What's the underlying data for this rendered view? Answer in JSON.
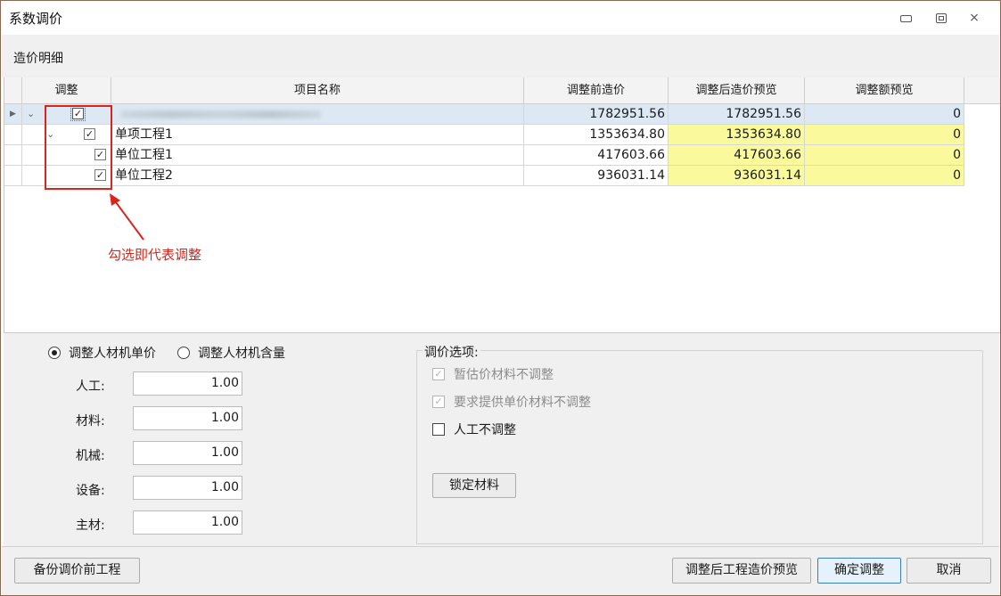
{
  "window": {
    "title": "系数调价",
    "close_glyph": "⨯"
  },
  "section": {
    "title": "造价明细"
  },
  "grid": {
    "columns": [
      "调整",
      "项目名称",
      "调整前造价",
      "调整后造价预览",
      "调整额预览"
    ],
    "rows": [
      {
        "name": "",
        "before": "1782951.56",
        "after": "1782951.56",
        "delta": "0"
      },
      {
        "name": "单项工程1",
        "before": "1353634.80",
        "after": "1353634.80",
        "delta": "0"
      },
      {
        "name": "单位工程1",
        "before": "417603.66",
        "after": "417603.66",
        "delta": "0"
      },
      {
        "name": "单位工程2",
        "before": "936031.14",
        "after": "936031.14",
        "delta": "0"
      }
    ],
    "annotation": "勾选即代表调整"
  },
  "adjust_mode": {
    "option1": "调整人材机单价",
    "option2": "调整人材机含量"
  },
  "coefficients": [
    {
      "label": "人工:",
      "value": "1.00"
    },
    {
      "label": "材料:",
      "value": "1.00"
    },
    {
      "label": "机械:",
      "value": "1.00"
    },
    {
      "label": "设备:",
      "value": "1.00"
    },
    {
      "label": "主材:",
      "value": "1.00"
    }
  ],
  "options": {
    "title": "调价选项:",
    "opt1": "暂估价材料不调整",
    "opt2": "要求提供单价材料不调整",
    "opt3": "人工不调整",
    "lock_button": "锁定材料"
  },
  "footer": {
    "backup_button": "备份调价前工程",
    "preview_button": "调整后工程造价预览",
    "confirm_button": "确定调整",
    "cancel_button": "取消"
  },
  "colors": {
    "highlight_yellow": "#fafa9c",
    "selected_row": "#dce9f5",
    "annotation_red": "#d9251c"
  },
  "icons": [
    "minimize-icon",
    "restore-icon",
    "close-icon",
    "expand-arrow-icon",
    "collapse-chevron-icon",
    "checkbox-checked-icon",
    "radio-icon"
  ]
}
